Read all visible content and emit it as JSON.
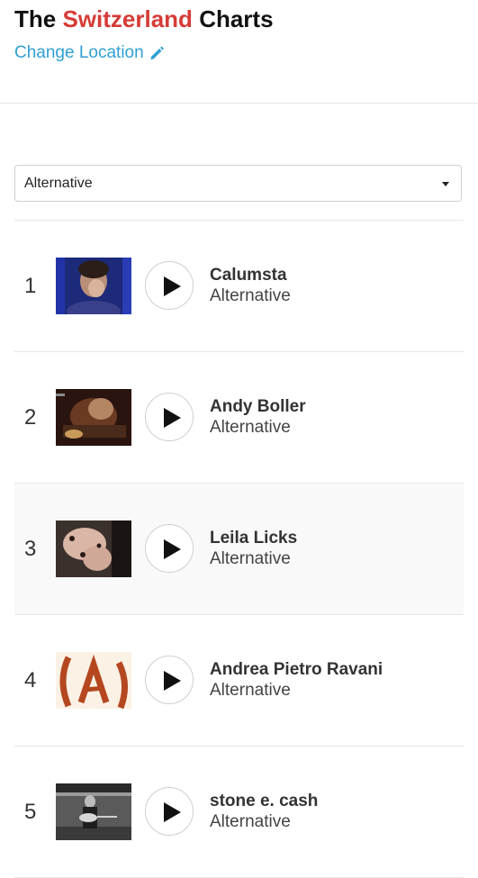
{
  "header": {
    "title_prefix": "The",
    "country": "Switzerland",
    "title_suffix": "Charts",
    "change_location": "Change Location",
    "country_color": "#d63b36",
    "link_color": "#2f9fd3",
    "pencil_icon": "pencil-icon"
  },
  "genre_select": {
    "selected": "Alternative"
  },
  "chart": [
    {
      "rank": "1",
      "artist": "Calumsta",
      "genre": "Alternative",
      "thumb_icon": "artist-photo"
    },
    {
      "rank": "2",
      "artist": "Andy Boller",
      "genre": "Alternative",
      "thumb_icon": "artist-photo"
    },
    {
      "rank": "3",
      "artist": "Leila Licks",
      "genre": "Alternative",
      "thumb_icon": "artist-photo"
    },
    {
      "rank": "4",
      "artist": "Andrea Pietro Ravani",
      "genre": "Alternative",
      "thumb_icon": "artist-logo"
    },
    {
      "rank": "5",
      "artist": "stone e. cash",
      "genre": "Alternative",
      "thumb_icon": "artist-photo"
    }
  ]
}
